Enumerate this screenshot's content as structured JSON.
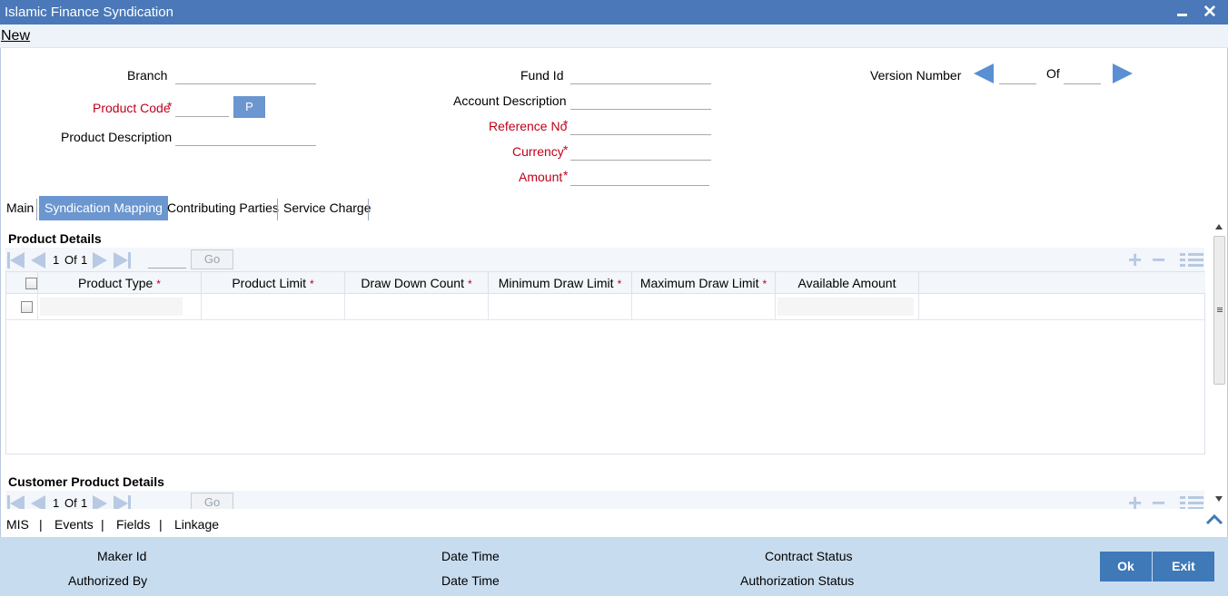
{
  "window": {
    "title": "Islamic Finance Syndication",
    "minimize_icon": "minimize-icon",
    "close_icon": "close-icon",
    "accent": "#4A78B8"
  },
  "menu": {
    "new_label": "New"
  },
  "header": {
    "branch_label": "Branch",
    "branch_value": "",
    "product_code_label": "Product Code",
    "product_code_value": "",
    "product_lov_label": "P",
    "product_description_label": "Product Description",
    "product_description_value": "",
    "fund_id_label": "Fund Id",
    "fund_id_value": "",
    "account_description_label": "Account Description",
    "account_description_value": "",
    "reference_no_label": "Reference No",
    "reference_no_value": "",
    "currency_label": "Currency",
    "currency_value": "",
    "amount_label": "Amount",
    "amount_value": "",
    "version_number_label": "Version Number",
    "version_current": "",
    "of_label": "Of",
    "version_total": "",
    "required_mark": "*"
  },
  "tabs": [
    {
      "label": "Main",
      "active": false
    },
    {
      "label": "Syndication Mapping",
      "active": true
    },
    {
      "label": "Contributing Parties",
      "active": false
    },
    {
      "label": "Service Charge",
      "active": false
    }
  ],
  "product_details": {
    "title": "Product Details",
    "pager": {
      "current": "1",
      "of_label": "Of",
      "total": "1",
      "go_label": "Go"
    },
    "columns": [
      {
        "label": "Product Type",
        "required": true
      },
      {
        "label": "Product Limit",
        "required": true
      },
      {
        "label": "Draw Down Count",
        "required": true
      },
      {
        "label": "Minimum Draw Limit",
        "required": true
      },
      {
        "label": "Maximum Draw Limit",
        "required": true
      },
      {
        "label": "Available Amount",
        "required": false
      }
    ],
    "rows": [
      {
        "product_type": "",
        "product_limit": "",
        "draw_down_count": "",
        "minimum_draw_limit": "",
        "maximum_draw_limit": "",
        "available_amount": ""
      }
    ]
  },
  "customer_product_details": {
    "title": "Customer Product Details",
    "pager": {
      "current": "1",
      "of_label": "Of",
      "total": "1",
      "go_label": "Go"
    }
  },
  "sublinks": [
    "MIS",
    "Events",
    "Fields",
    "Linkage"
  ],
  "sublink_separator": "|",
  "footer": {
    "maker_id_label": "Maker Id",
    "date_time_label_1": "Date Time",
    "contract_status_label": "Contract Status",
    "authorized_by_label": "Authorized By",
    "date_time_label_2": "Date Time",
    "authorization_status_label": "Authorization Status",
    "ok_label": "Ok",
    "exit_label": "Exit"
  }
}
